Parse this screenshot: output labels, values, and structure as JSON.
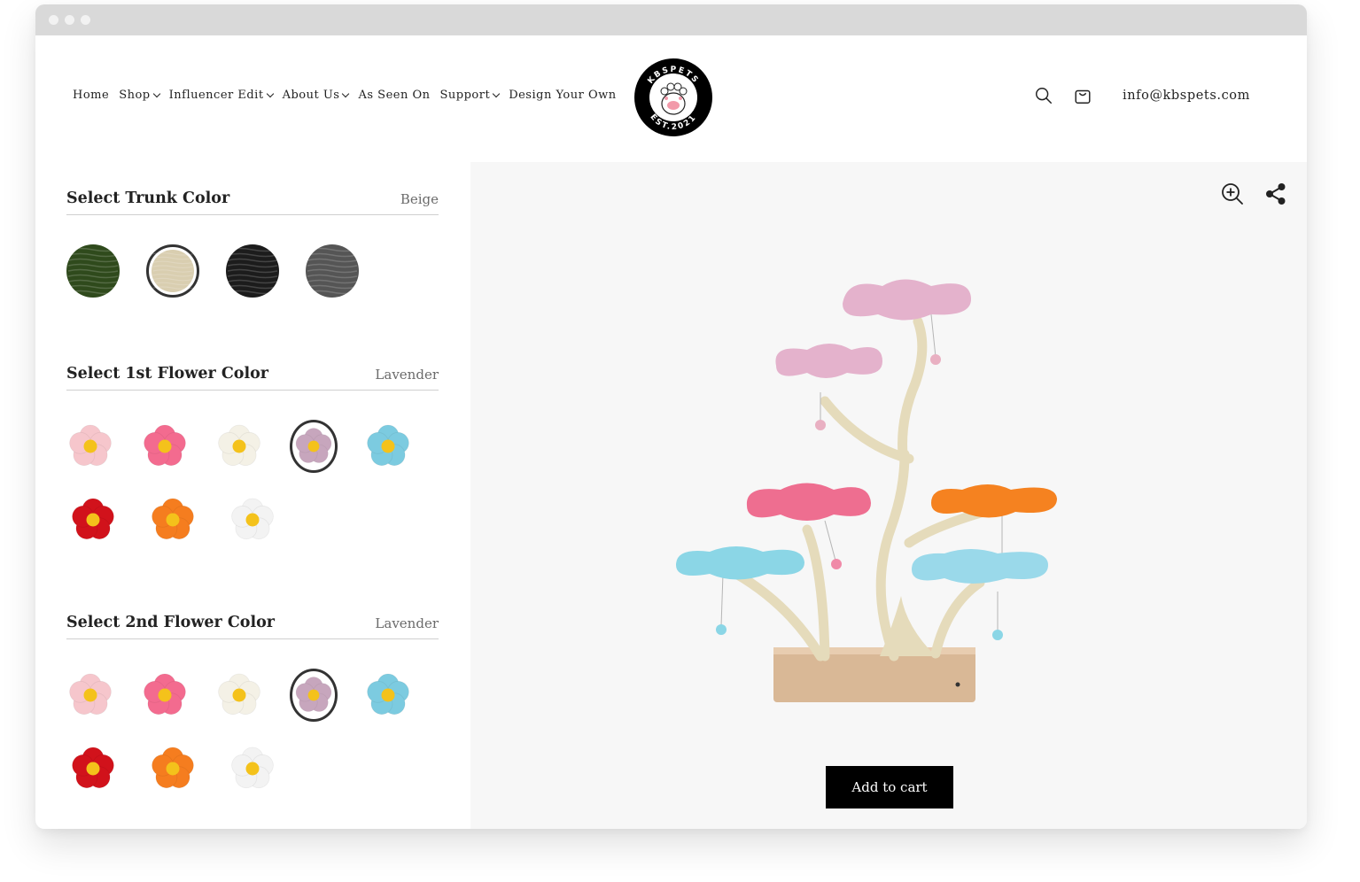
{
  "nav": {
    "items": [
      {
        "label": "Home",
        "has_dropdown": false
      },
      {
        "label": "Shop",
        "has_dropdown": true
      },
      {
        "label": "Influencer Edit",
        "has_dropdown": true
      },
      {
        "label": "About Us",
        "has_dropdown": true
      },
      {
        "label": "As Seen On",
        "has_dropdown": false
      },
      {
        "label": "Support",
        "has_dropdown": true
      },
      {
        "label": "Design Your Own",
        "has_dropdown": false
      }
    ]
  },
  "logo": {
    "brand_text": "KBSPETS",
    "est_text": "EST.2021"
  },
  "header_tools": {
    "search_icon": "search-icon",
    "cart_icon": "cart-icon",
    "email": "info@kbspets.com"
  },
  "trunk": {
    "title": "Select Trunk Color",
    "selected_value": "Beige",
    "swatches": [
      {
        "color": "#2f4a1c",
        "selected": false
      },
      {
        "color": "#d9ceb0",
        "selected": true
      },
      {
        "color": "#1c1c1c",
        "selected": false
      },
      {
        "color": "#555555",
        "selected": false
      }
    ]
  },
  "flower1": {
    "title": "Select 1st Flower Color",
    "selected_value": "Lavender",
    "swatches": [
      {
        "color": "#f6c6cc",
        "selected": false
      },
      {
        "color": "#f36b8f",
        "selected": false
      },
      {
        "color": "#f4f1e6",
        "selected": false
      },
      {
        "color": "#c7a6bd",
        "selected": true
      },
      {
        "color": "#7ccbe0",
        "selected": false
      },
      {
        "color": "#d1121b",
        "selected": false
      },
      {
        "color": "#f57d1f",
        "selected": false
      },
      {
        "color": "#f3f3f3",
        "selected": false
      }
    ]
  },
  "flower2": {
    "title": "Select 2nd Flower Color",
    "selected_value": "Lavender",
    "swatches": [
      {
        "color": "#f6c6cc",
        "selected": false
      },
      {
        "color": "#f36b8f",
        "selected": false
      },
      {
        "color": "#f4f1e6",
        "selected": false
      },
      {
        "color": "#c7a6bd",
        "selected": true
      },
      {
        "color": "#7ccbe0",
        "selected": false
      },
      {
        "color": "#d1121b",
        "selected": false
      },
      {
        "color": "#f57d1f",
        "selected": false
      },
      {
        "color": "#f3f3f3",
        "selected": false
      }
    ]
  },
  "preview": {
    "zoom_icon": "zoom-in-icon",
    "share_icon": "share-icon",
    "add_to_cart_label": "Add to cart"
  }
}
